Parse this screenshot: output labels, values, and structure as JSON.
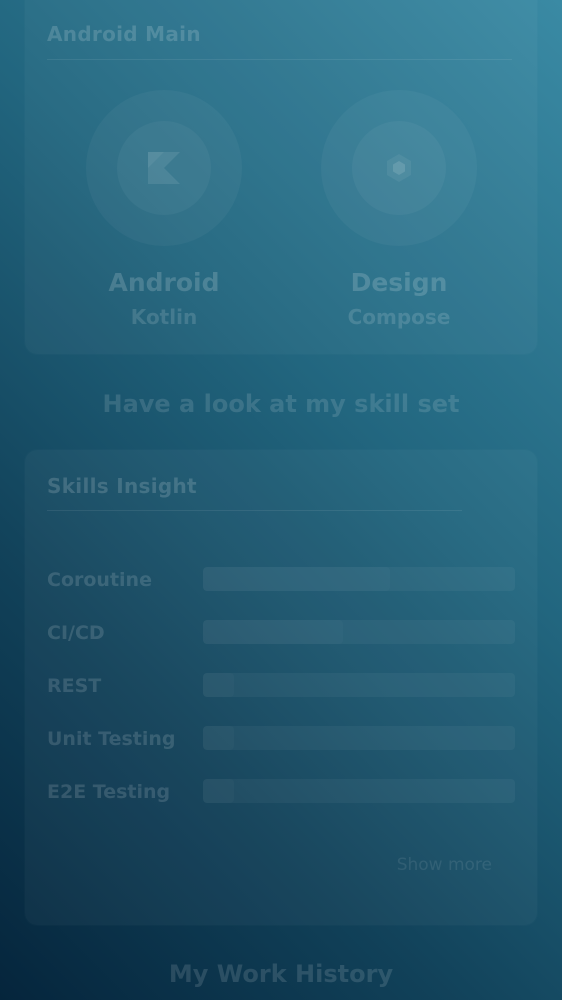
{
  "top_card": {
    "title": "Android Main",
    "items": [
      {
        "name": "Android",
        "sub": "Kotlin",
        "icon": "kotlin-logo-icon"
      },
      {
        "name": "Design",
        "sub": "Compose",
        "icon": "compose-logo-icon"
      }
    ]
  },
  "headline": "Have a look at my skill set",
  "skills_card": {
    "title": "Skills Insight",
    "skills": [
      {
        "label": "Coroutine",
        "level": 0.6
      },
      {
        "label": "CI/CD",
        "level": 0.45
      },
      {
        "label": "REST",
        "level": 0.1
      },
      {
        "label": "Unit Testing",
        "level": 0.1
      },
      {
        "label": "E2E Testing",
        "level": 0.1
      }
    ],
    "show_more": "Show more"
  },
  "next_section": "My Work History"
}
